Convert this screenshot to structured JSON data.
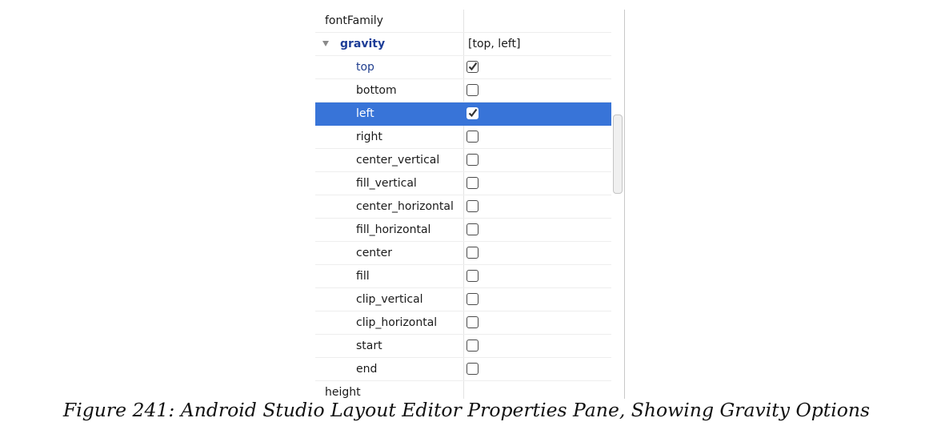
{
  "properties_pane": {
    "top_rows_before": [
      {
        "name": "fontFamily",
        "value": ""
      }
    ],
    "group": {
      "name": "gravity",
      "value": "[top, left]",
      "expanded": true
    },
    "gravity_options": [
      {
        "name": "top",
        "checked": true,
        "modified": true,
        "selected": false
      },
      {
        "name": "bottom",
        "checked": false,
        "modified": false,
        "selected": false
      },
      {
        "name": "left",
        "checked": true,
        "modified": false,
        "selected": true
      },
      {
        "name": "right",
        "checked": false,
        "modified": false,
        "selected": false
      },
      {
        "name": "center_vertical",
        "checked": false,
        "modified": false,
        "selected": false
      },
      {
        "name": "fill_vertical",
        "checked": false,
        "modified": false,
        "selected": false
      },
      {
        "name": "center_horizontal",
        "checked": false,
        "modified": false,
        "selected": false
      },
      {
        "name": "fill_horizontal",
        "checked": false,
        "modified": false,
        "selected": false
      },
      {
        "name": "center",
        "checked": false,
        "modified": false,
        "selected": false
      },
      {
        "name": "fill",
        "checked": false,
        "modified": false,
        "selected": false
      },
      {
        "name": "clip_vertical",
        "checked": false,
        "modified": false,
        "selected": false
      },
      {
        "name": "clip_horizontal",
        "checked": false,
        "modified": false,
        "selected": false
      },
      {
        "name": "start",
        "checked": false,
        "modified": false,
        "selected": false
      },
      {
        "name": "end",
        "checked": false,
        "modified": false,
        "selected": false
      }
    ],
    "top_rows_after": [
      {
        "name": "height",
        "value": ""
      }
    ]
  },
  "colors": {
    "selection": "#3874d8",
    "group_label": "#1d3d97"
  },
  "icons": {
    "expand": "triangle-down-icon",
    "check": "checkmark-icon"
  },
  "caption": "Figure 241: Android Studio Layout Editor Properties Pane, Showing Gravity Options"
}
